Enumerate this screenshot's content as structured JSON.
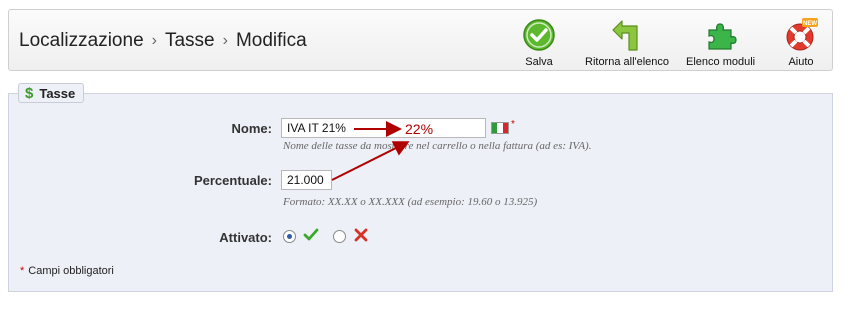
{
  "breadcrumb": {
    "items": [
      "Localizzazione",
      "Tasse",
      "Modifica"
    ],
    "separator": "›"
  },
  "toolbar": {
    "save_label": "Salva",
    "back_label": "Ritorna all'elenco",
    "modules_label": "Elenco moduli",
    "help_label": "Aiuto",
    "help_badge": "NEW"
  },
  "panel": {
    "legend": "Tasse",
    "legend_icon": "dollar-icon"
  },
  "form": {
    "name_label": "Nome:",
    "name_value": "IVA IT 21%",
    "name_hint": "Nome delle tasse da mostrare nel carrello o nella fattura (ad es: IVA).",
    "percent_label": "Percentuale:",
    "percent_value": "21.000",
    "percent_hint": "Formato: XX.XX o XX.XXX (ad esempio: 19.60 o 13.925)",
    "active_label": "Attivato:",
    "active_selected": "yes",
    "required_star": "*",
    "required_note": "Campi obbligatori"
  },
  "annotation": {
    "text": "22%",
    "color": "#b00000"
  },
  "colors": {
    "panel_bg": "#eef0f7",
    "accent_green": "#3a9a2b",
    "error_red": "#c00000"
  }
}
